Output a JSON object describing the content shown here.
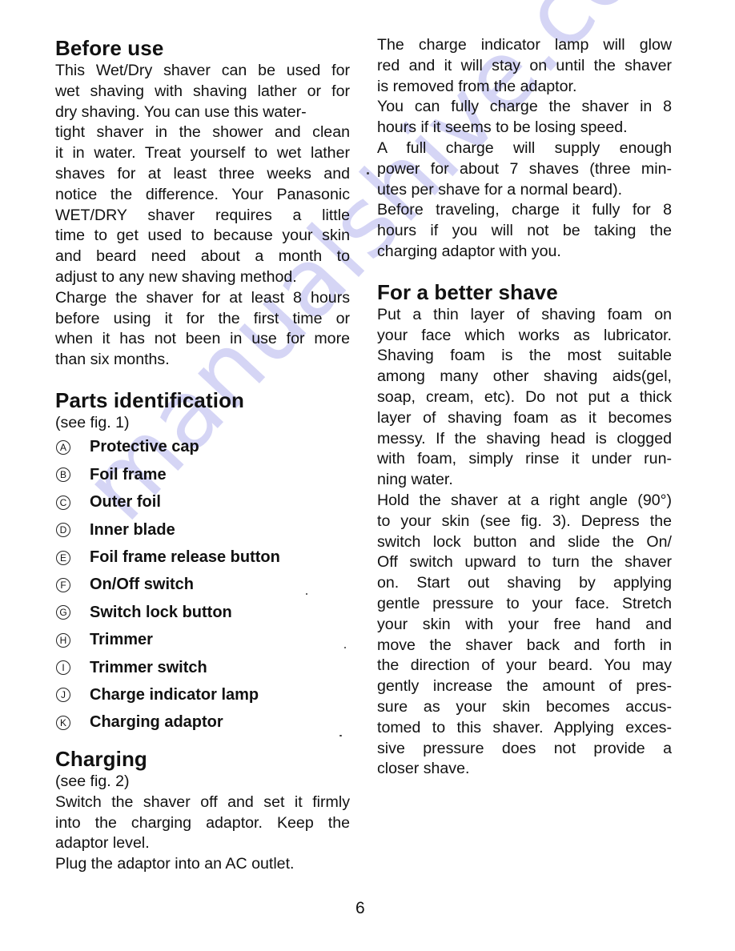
{
  "page_number": "6",
  "watermark": "manualshive.com",
  "left_column": {
    "before_use": {
      "heading": "Before use",
      "lines": [
        "This Wet/Dry shaver can be used for",
        "wet shaving with shaving lather or for",
        "dry shaving. You can use this water-",
        "tight shaver in the shower and clean",
        "it in water. Treat yourself to wet lather",
        "shaves for at least three weeks and",
        "notice the difference. Your Panasonic",
        "WET/DRY shaver requires a little",
        "time to get used to because your skin",
        "and beard need about a month to",
        "adjust to any new shaving method.",
        "Charge the shaver for at least 8 hours",
        "before using it for the first time or",
        "when it has not been in use for more",
        "than six months."
      ]
    },
    "parts_identification": {
      "heading": "Parts identification",
      "subheading": "(see fig. 1)",
      "items": [
        {
          "letter": "A",
          "label": "Protective cap"
        },
        {
          "letter": "B",
          "label": "Foil frame"
        },
        {
          "letter": "C",
          "label": "Outer foil"
        },
        {
          "letter": "D",
          "label": "Inner blade"
        },
        {
          "letter": "E",
          "label": "Foil frame release button"
        },
        {
          "letter": "F",
          "label": "On/Off switch"
        },
        {
          "letter": "G",
          "label": "Switch lock button"
        },
        {
          "letter": "H",
          "label": "Trimmer"
        },
        {
          "letter": "I",
          "label": "Trimmer switch"
        },
        {
          "letter": "J",
          "label": "Charge indicator lamp"
        },
        {
          "letter": "K",
          "label": "Charging adaptor"
        }
      ]
    },
    "charging": {
      "heading": "Charging",
      "subheading": "(see fig. 2)",
      "lines": [
        "Switch the shaver off and set it firmly",
        "into the charging adaptor. Keep the",
        "adaptor level.",
        "Plug the adaptor into an AC outlet."
      ]
    }
  },
  "right_column": {
    "charging_continued": {
      "lines": [
        "The charge indicator lamp will glow",
        "red and it will stay on until the shaver",
        "is removed from the adaptor.",
        "You can fully charge the shaver in 8",
        "hours if it seems to be losing speed.",
        "A full charge will supply enough",
        "power for about 7 shaves (three min-",
        "utes per shave for a normal beard).",
        "Before traveling, charge it fully for 8",
        "hours if you will not be taking the",
        "charging adaptor with you."
      ]
    },
    "better_shave": {
      "heading": "For a better shave",
      "lines": [
        "Put a thin layer of shaving foam on",
        "your face which works as lubricator.",
        "Shaving foam is the most suitable",
        "among many other shaving aids(gel,",
        "soap, cream, etc). Do not put a thick",
        "layer of shaving foam as it becomes",
        "messy. If the shaving head is clogged",
        "with foam, simply rinse it under run-",
        "ning water.",
        "Hold the shaver at a right angle (90°)",
        "to your skin (see fig. 3). Depress the",
        "switch lock button and slide the On/",
        "Off switch upward to turn the shaver",
        "on. Start out shaving by applying",
        "gentle pressure to your face. Stretch",
        "your skin with your free hand and",
        "move the shaver back and forth in",
        "the direction of your beard. You may",
        "gently increase the amount of pres-",
        "sure as your skin becomes accus-",
        "tomed to this shaver. Applying exces-",
        "sive pressure does not provide a",
        "closer shave."
      ]
    }
  }
}
